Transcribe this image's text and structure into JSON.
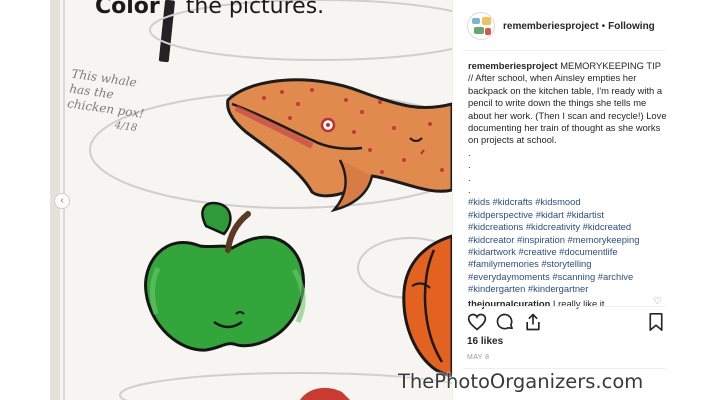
{
  "photo": {
    "sheet_title_bold": "Color",
    "sheet_title_rest": "the pictures.",
    "handwritten_note": "This whale has the chicken pox!",
    "handwritten_date": "4/18"
  },
  "post": {
    "username": "rememberiesproject",
    "separator": "•",
    "follow_status": "Following",
    "caption_user": "rememberiesproject",
    "caption_text": "MEMORYKEEPING TIP // After school, when Ainsley empties her backpack on the kitchen table, I'm ready with a pencil to write down the things she tells me about her work. (Then I scan and recycle!) Love documenting her train of thought as she works on projects at school.",
    "dots": [
      ".",
      ".",
      ".",
      "."
    ],
    "hashtag_lines": [
      "#kids #kidcrafts #kidsmood",
      "#kidperspective #kidart #kidartist",
      "#kidcreations #kidcreativity #kidcreated",
      "#kidcreator #inspiration #memorykeeping",
      "#kidartwork #creative #documentlife",
      "#familymemories #storytelling",
      "#everydaymoments #scanning #archive",
      "#kindergarten #kindergartner"
    ],
    "comment_user": "thejournalcuration",
    "comment_text": "I really like it",
    "likes": "16 likes",
    "date": "MAY 8"
  },
  "watermark": "ThePhotoOrganizers.com",
  "icons": {
    "like": "heart-icon",
    "comment": "comment-icon",
    "share": "share-icon",
    "save": "bookmark-icon"
  },
  "colors": {
    "hashtag": "#2a4f82",
    "whale": "#e07a45",
    "apple": "#2e9e36",
    "pumpkin": "#e8621e"
  }
}
